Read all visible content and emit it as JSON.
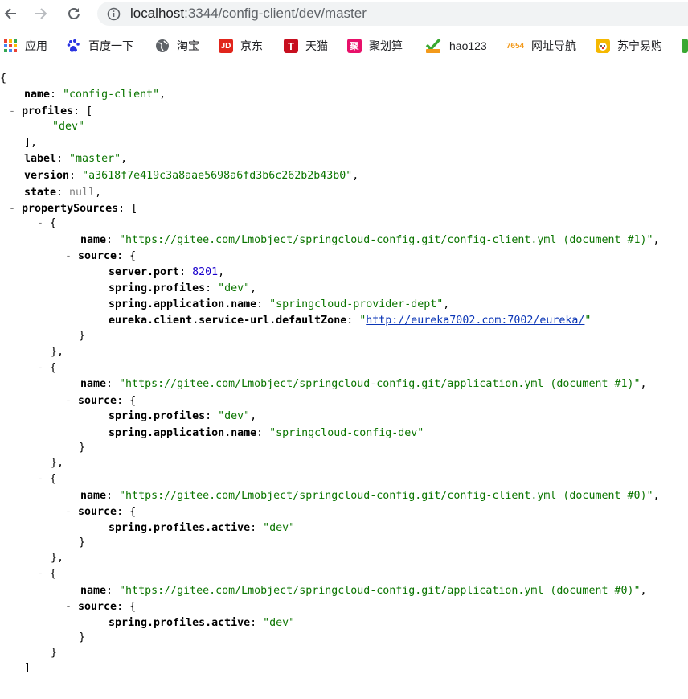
{
  "browser": {
    "url_host": "localhost",
    "url_rest": ":3344/config-client/dev/master",
    "bookmarks": [
      {
        "label": "应用",
        "icon": "apps-grid-icon",
        "color": "#1a73e8"
      },
      {
        "label": "百度一下",
        "icon": "baidu-paw-icon",
        "color": "#2932e1"
      },
      {
        "label": "淘宝",
        "icon": "globe-icon",
        "color": "#5f6368"
      },
      {
        "label": "京东",
        "icon": "jd-logo-icon",
        "color": "#e1251b"
      },
      {
        "label": "天猫",
        "icon": "tmall-logo-icon",
        "color": "#c70f1f"
      },
      {
        "label": "聚划算",
        "icon": "juhuasuan-logo-icon",
        "color": "#e8106a"
      },
      {
        "label": "hao123",
        "icon": "hao123-logo-icon",
        "color": "#3aa832"
      },
      {
        "label": "网址导航",
        "icon": "7654-logo-icon",
        "color": "#f39a1b"
      },
      {
        "label": "苏宁易购",
        "icon": "suning-logo-icon",
        "color": "#f5b800"
      }
    ]
  },
  "json": {
    "open_brace": "{",
    "name_key": "name",
    "name_val": "\"config-client\"",
    "profiles_key": "profiles",
    "profiles_item": "\"dev\"",
    "label_key": "label",
    "label_val": "\"master\"",
    "version_key": "version",
    "version_val": "\"a3618f7e419c3a8aae5698a6fd3b6c262b2b43b0\"",
    "state_key": "state",
    "state_val": "null",
    "ps_key": "propertySources",
    "sources": [
      {
        "name_val": "\"https://gitee.com/Lmobject/springcloud-config.git/config-client.yml (document #1)\"",
        "props": [
          {
            "key": "server.port",
            "val": "8201",
            "type": "n"
          },
          {
            "key": "spring.profiles",
            "val": "\"dev\"",
            "type": "s"
          },
          {
            "key": "spring.application.name",
            "val": "\"springcloud-provider-dept\"",
            "type": "s"
          },
          {
            "key": "eureka.client.service-url.defaultZone",
            "val_pre": "\"",
            "link": "http://eureka7002.com:7002/eureka/",
            "val_post": "\"",
            "type": "link"
          }
        ]
      },
      {
        "name_val": "\"https://gitee.com/Lmobject/springcloud-config.git/application.yml (document #1)\"",
        "props": [
          {
            "key": "spring.profiles",
            "val": "\"dev\"",
            "type": "s"
          },
          {
            "key": "spring.application.name",
            "val": "\"springcloud-config-dev\"",
            "type": "s"
          }
        ]
      },
      {
        "name_val": "\"https://gitee.com/Lmobject/springcloud-config.git/config-client.yml (document #0)\"",
        "props": [
          {
            "key": "spring.profiles.active",
            "val": "\"dev\"",
            "type": "s"
          }
        ]
      },
      {
        "name_val": "\"https://gitee.com/Lmobject/springcloud-config.git/application.yml (document #0)\"",
        "props": [
          {
            "key": "spring.profiles.active",
            "val": "\"dev\"",
            "type": "s"
          }
        ]
      }
    ],
    "source_key": "source",
    "toggle_glyph": "-"
  }
}
